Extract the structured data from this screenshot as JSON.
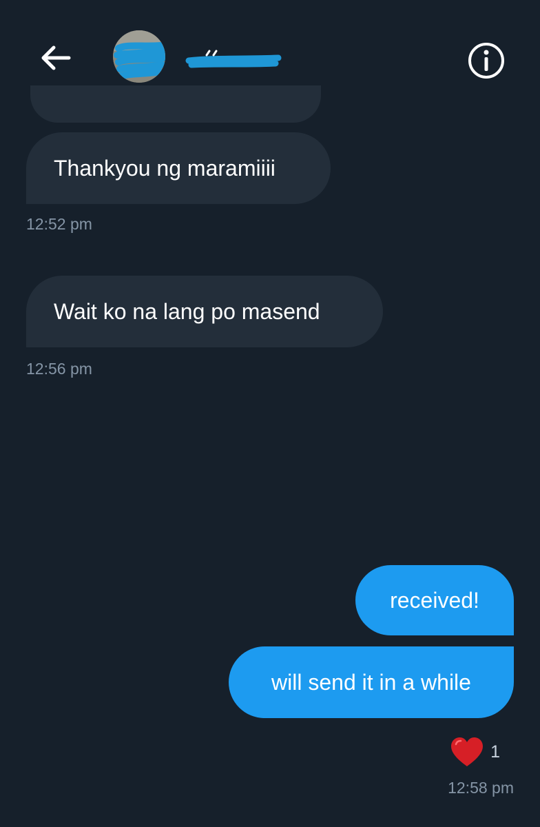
{
  "header": {
    "back_icon": "arrow-left-icon",
    "info_icon": "info-icon",
    "avatar": "contact-avatar-redacted"
  },
  "messages": [
    {
      "direction": "incoming",
      "text": "Thankyou ng maramiiii",
      "time": "12:52 pm"
    },
    {
      "direction": "incoming",
      "text": "Wait ko na lang po masend",
      "time": "12:56 pm"
    },
    {
      "direction": "outgoing",
      "text": "received!"
    },
    {
      "direction": "outgoing",
      "text": "will send it in a while",
      "time": "12:58 pm"
    }
  ],
  "reaction": {
    "icon": "heart-icon",
    "count": "1"
  },
  "colors": {
    "background": "#16202b",
    "incoming_bubble": "#232e3a",
    "outgoing_bubble": "#1d9bf0",
    "timestamp": "#8595a6",
    "heart": "#d61f26",
    "redaction": "#1f97d6"
  }
}
